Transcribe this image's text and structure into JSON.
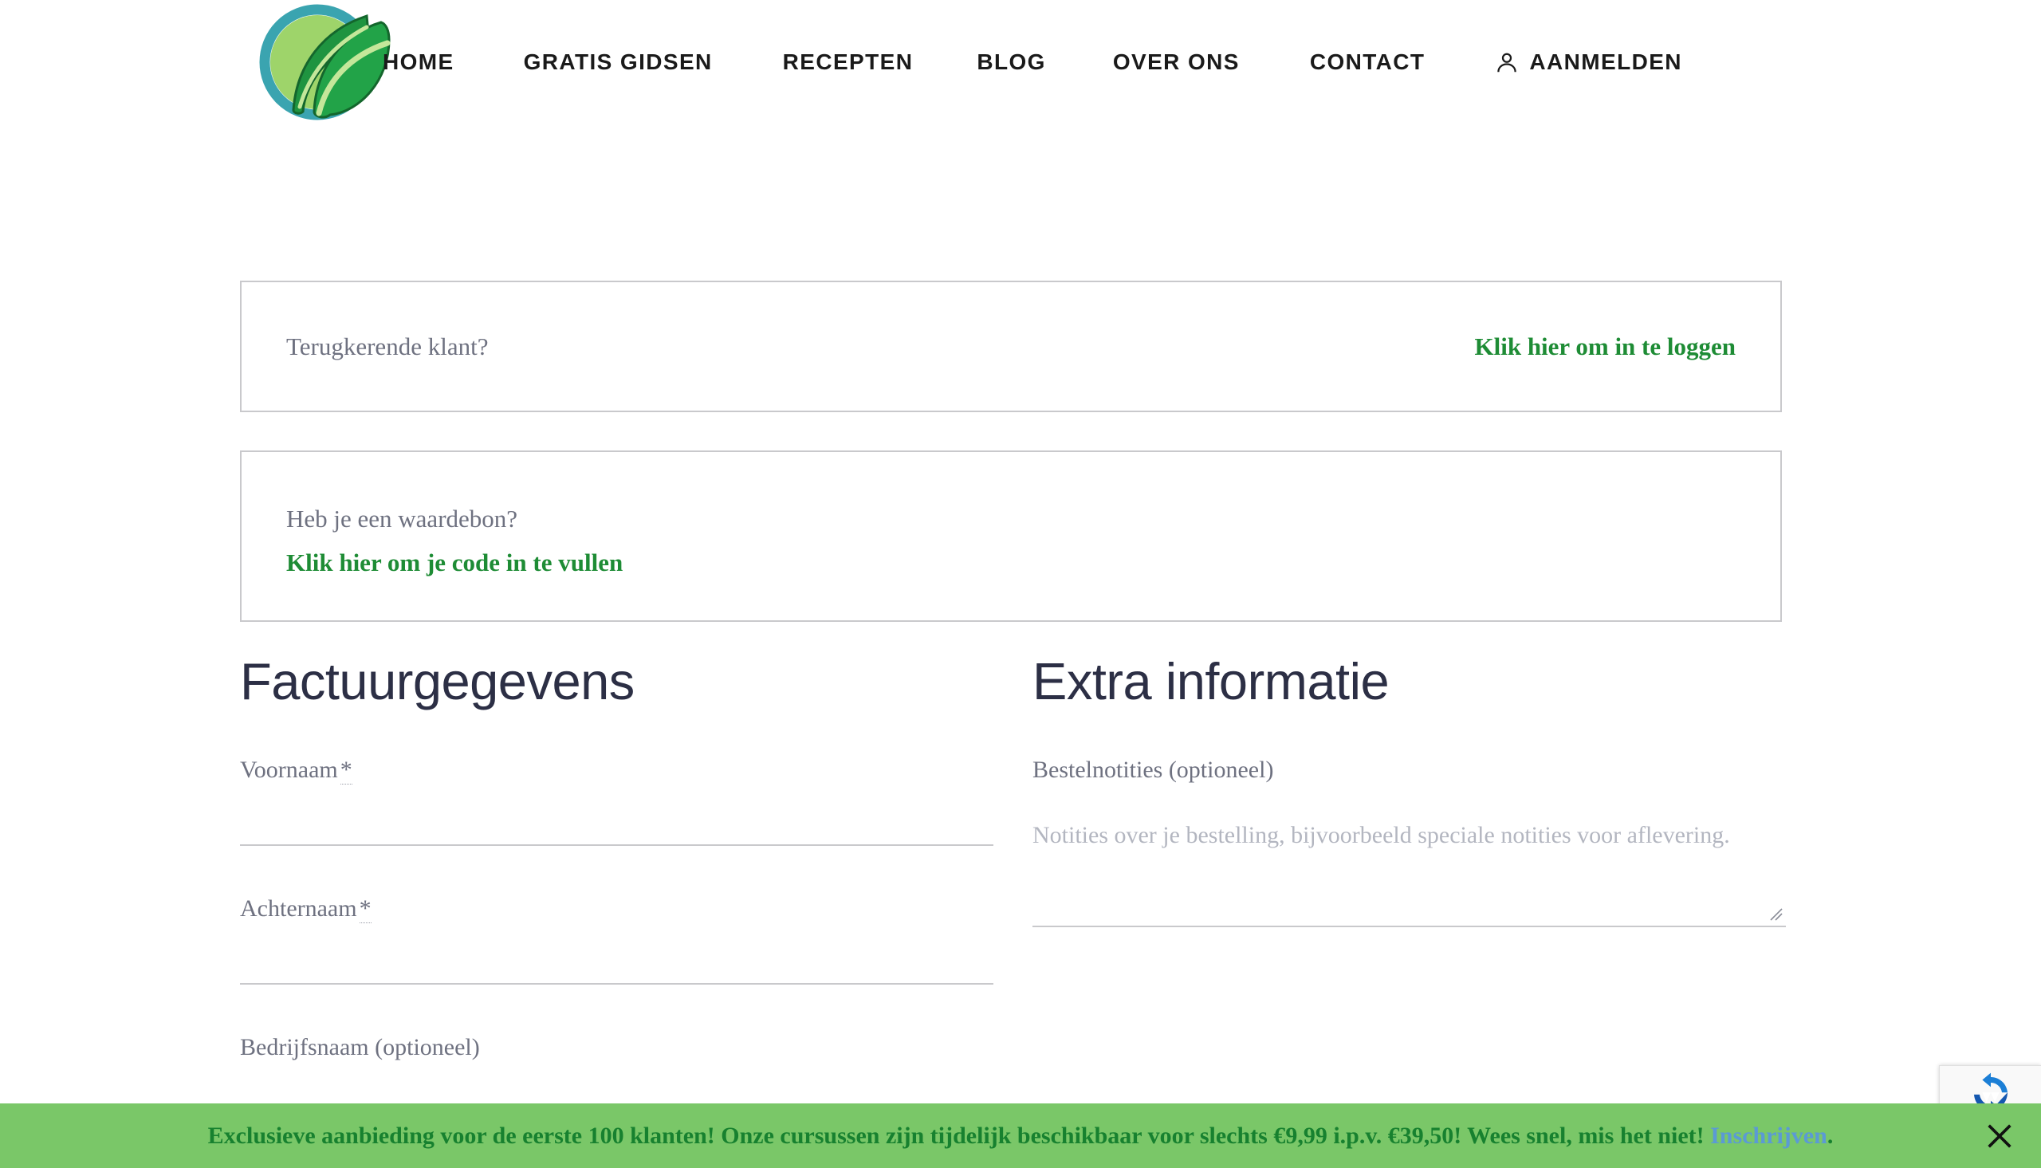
{
  "header": {
    "logo_alt": "leaf-logo",
    "nav": [
      {
        "label": "HOME",
        "icon": null
      },
      {
        "label": "GRATIS GIDSEN",
        "icon": null
      },
      {
        "label": "RECEPTEN",
        "icon": null
      },
      {
        "label": "BLOG",
        "icon": null
      },
      {
        "label": "OVER ONS",
        "icon": null
      },
      {
        "label": "CONTACT",
        "icon": null
      },
      {
        "label": "AANMELDEN",
        "icon": "user-icon"
      }
    ]
  },
  "login_notice": {
    "text": "Terugkerende klant?",
    "link": "Klik hier om in te loggen"
  },
  "coupon_notice": {
    "text": "Heb je een waardebon?",
    "link": "Klik hier om je code in te vullen"
  },
  "billing": {
    "title": "Factuurgegevens",
    "fields": [
      {
        "label": "Voornaam",
        "required": "*",
        "value": "",
        "placeholder": ""
      },
      {
        "label": "Achternaam",
        "required": "*",
        "value": "",
        "placeholder": ""
      },
      {
        "label": "Bedrijfsnaam (optioneel)",
        "required": "",
        "value": "",
        "placeholder": ""
      }
    ]
  },
  "extra": {
    "title": "Extra informatie",
    "notes_label": "Bestelnotities (optioneel)",
    "notes_placeholder": "Notities over je bestelling, bijvoorbeeld speciale notities voor aflevering.",
    "notes_value": ""
  },
  "recaptcha": {
    "icon": "recaptcha-icon"
  },
  "promo": {
    "message": "Exclusieve aanbieding voor de eerste 100 klanten! Onze cursussen zijn tijdelijk beschikbaar voor slechts €9,99 i.p.v. €39,50! Wees snel, mis het niet! ",
    "link": "Inschrijven",
    "tail": ".",
    "close_icon": "close-icon",
    "background": "#7ac768",
    "text_color": "#17812f",
    "link_color": "#5b9ad5"
  },
  "colors": {
    "green_link": "#1e8c35",
    "heading": "#2c2f45",
    "muted": "#6e7180",
    "border": "#c9c9cc"
  }
}
